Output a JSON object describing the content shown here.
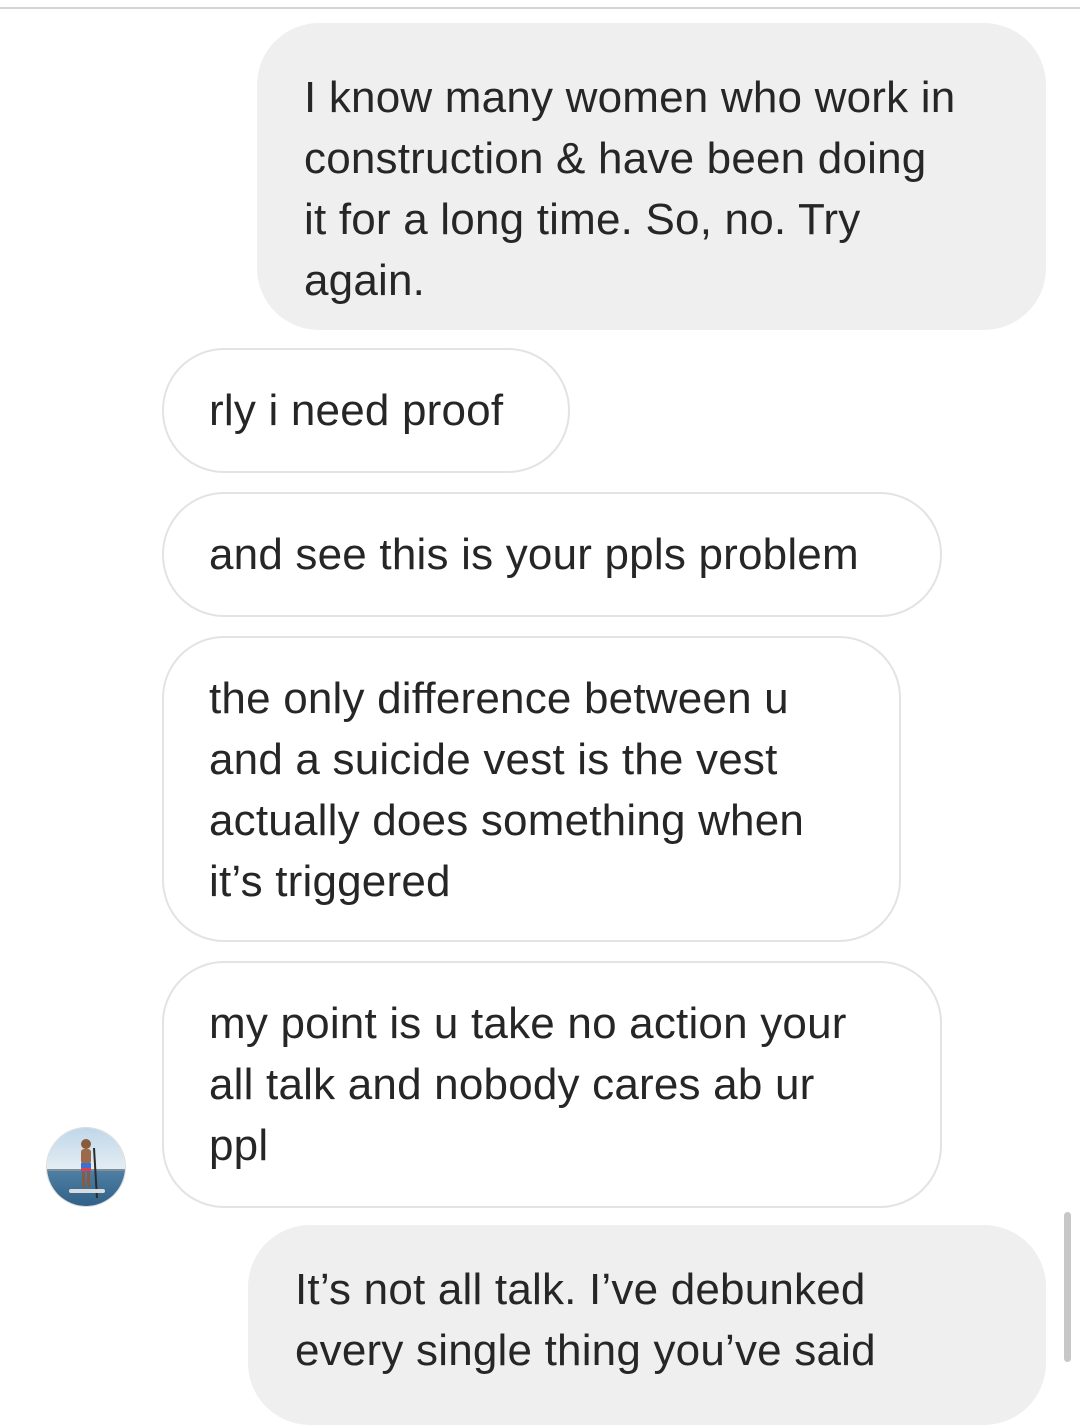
{
  "thread": {
    "messages": [
      {
        "direction": "sent",
        "text": "I know many women who work in\nconstruction & have been doing\nit for a long time. So, no. Try\nagain."
      },
      {
        "direction": "received",
        "text": "rly i need proof"
      },
      {
        "direction": "received",
        "text": "and see this is your ppls problem"
      },
      {
        "direction": "received",
        "text": "the only difference between u\nand a suicide vest is the vest\nactually does something when\nit’s triggered"
      },
      {
        "direction": "received",
        "text": "my point is u take no action your\nall talk and nobody cares ab ur\nppl"
      },
      {
        "direction": "sent",
        "text": "It’s not all talk. I’ve debunked\nevery single thing you’ve said"
      }
    ]
  },
  "colors": {
    "sent_bubble": "#efefef",
    "received_border": "#e3e3e3",
    "text": "#262626",
    "scrollbar": "#c7c7c7"
  },
  "icons": {
    "sender_avatar": "profile-photo-avatar"
  }
}
